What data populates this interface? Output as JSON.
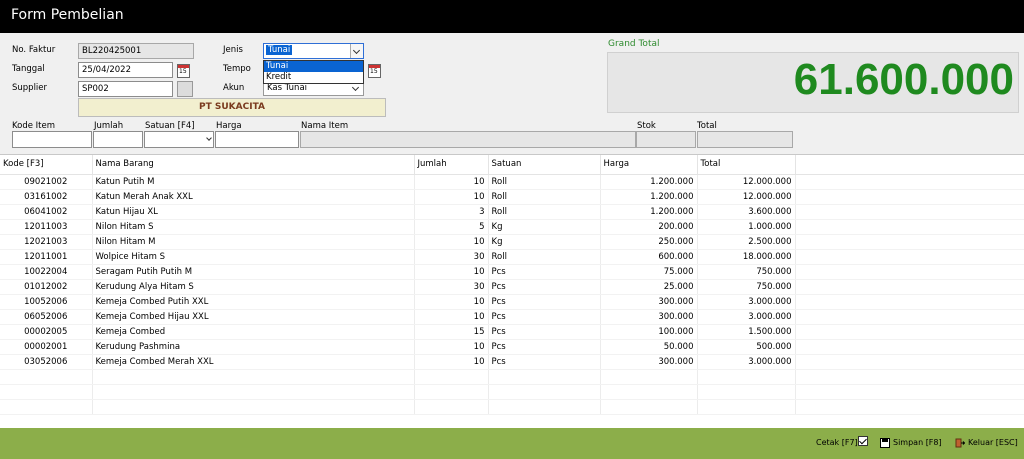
{
  "window": {
    "title": "Form Pembelian"
  },
  "header": {
    "no_faktur_label": "No. Faktur",
    "no_faktur_value": "BL220425001",
    "tanggal_label": "Tanggal",
    "tanggal_value": "25/04/2022",
    "supplier_label": "Supplier",
    "supplier_value": "SP002",
    "supplier_name": "PT SUKACITA",
    "jenis_label": "Jenis",
    "jenis_value": "Tunai",
    "jenis_options": [
      "Tunai",
      "Kredit"
    ],
    "tempo_label": "Tempo",
    "akun_label": "Akun",
    "akun_value": "Kas Tunai",
    "calendar_day": "15"
  },
  "grand_total": {
    "label": "Grand Total",
    "value": "61.600.000"
  },
  "entry": {
    "labels": [
      "Kode Item",
      "Jumlah",
      "Satuan [F4]",
      "Harga",
      "Nama Item",
      "Stok",
      "Total"
    ]
  },
  "table": {
    "columns": [
      "Kode [F3]",
      "Nama Barang",
      "Jumlah",
      "Satuan",
      "Harga",
      "Total"
    ],
    "rows": [
      [
        "09021002",
        "Katun Putih M",
        "10",
        "Roll",
        "1.200.000",
        "12.000.000"
      ],
      [
        "03161002",
        "Katun Merah Anak XXL",
        "10",
        "Roll",
        "1.200.000",
        "12.000.000"
      ],
      [
        "06041002",
        "Katun Hijau XL",
        "3",
        "Roll",
        "1.200.000",
        "3.600.000"
      ],
      [
        "12011003",
        "Nilon Hitam S",
        "5",
        "Kg",
        "200.000",
        "1.000.000"
      ],
      [
        "12021003",
        "Nilon Hitam M",
        "10",
        "Kg",
        "250.000",
        "2.500.000"
      ],
      [
        "12011001",
        "Wolpice Hitam S",
        "30",
        "Roll",
        "600.000",
        "18.000.000"
      ],
      [
        "10022004",
        "Seragam Putih  Putih M",
        "10",
        "Pcs",
        "75.000",
        "750.000"
      ],
      [
        "01012002",
        "Kerudung Alya Hitam S",
        "30",
        "Pcs",
        "25.000",
        "750.000"
      ],
      [
        "10052006",
        "Kemeja Combed Putih XXL",
        "10",
        "Pcs",
        "300.000",
        "3.000.000"
      ],
      [
        "06052006",
        "Kemeja Combed Hijau XXL",
        "10",
        "Pcs",
        "300.000",
        "3.000.000"
      ],
      [
        "00002005",
        "Kemeja Combed",
        "15",
        "Pcs",
        "100.000",
        "1.500.000"
      ],
      [
        "00002001",
        "Kerudung Pashmina",
        "10",
        "Pcs",
        "50.000",
        "500.000"
      ],
      [
        "03052006",
        "Kemeja Combed Merah XXL",
        "10",
        "Pcs",
        "300.000",
        "3.000.000"
      ]
    ]
  },
  "footer": {
    "cetak_label": "Cetak [F7]",
    "cetak_checked": true,
    "simpan_label": "Simpan [F8]",
    "keluar_label": "Keluar [ESC]"
  },
  "colors": {
    "title_bar": "#000000",
    "grand_total": "#1f8a1f",
    "footer": "#8cae4a",
    "selection": "#0a64d2",
    "supplier_name": "#7a3a1e"
  }
}
